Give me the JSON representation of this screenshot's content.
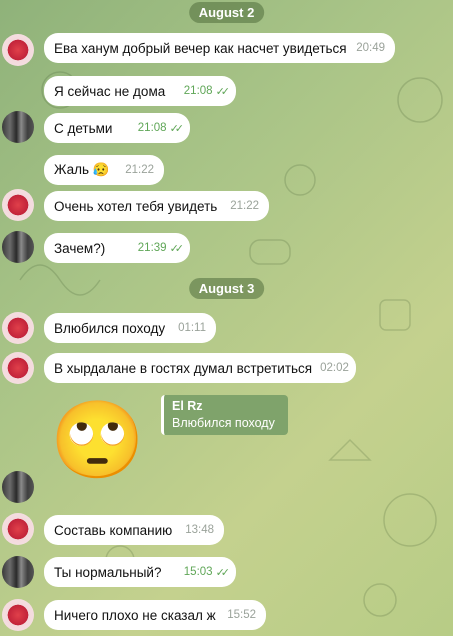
{
  "dates": [
    "August 2",
    "August 3"
  ],
  "messages": [
    {
      "text": "Ева ханум добрый вечер как насчет увидеться",
      "time": "20:49"
    },
    {
      "text": "Я сейчас не дома",
      "time": "21:08"
    },
    {
      "text": "С детьми",
      "time": "21:08"
    },
    {
      "text": "Жаль 😥",
      "time": "21:22"
    },
    {
      "text": "Очень хотел тебя увидеть",
      "time": "21:22"
    },
    {
      "text": "Зачем?)",
      "time": "21:39"
    },
    {
      "text": "Влюбился походу",
      "time": "01:11"
    },
    {
      "text": "В хырдалане в гостях думал встретиться",
      "time": "02:02"
    },
    {
      "text": "Составь компанию",
      "time": "13:48"
    },
    {
      "text": "Ты нормальный?",
      "time": "15:03"
    },
    {
      "text": "Ничего плохо не сказал ж",
      "time": "15:52"
    }
  ],
  "reply": {
    "name": "El Rz",
    "text": "Влюбился походу",
    "sticker": "🙄"
  },
  "colors": {
    "accent": "#5fa657",
    "bubble": "#ffffff",
    "avatar_red": "#d12c3c"
  },
  "icons": [
    "double-check-icon",
    "avatar-red-icon",
    "avatar-photo-icon",
    "emoji-sticker-icon"
  ]
}
